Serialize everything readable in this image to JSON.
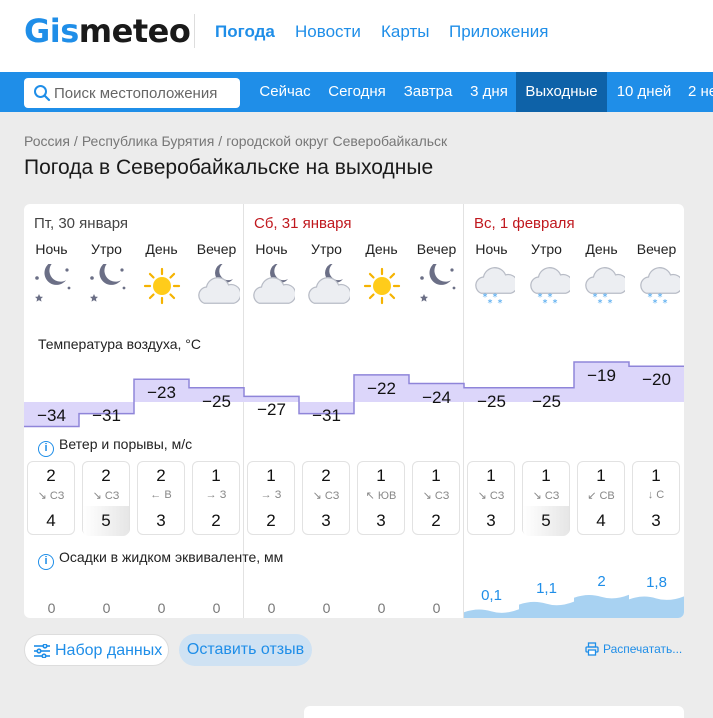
{
  "brand": {
    "logo_g": "Gis",
    "logo_rest": "meteo"
  },
  "topnav": [
    {
      "label": "Погода",
      "active": true
    },
    {
      "label": "Новости",
      "active": false
    },
    {
      "label": "Карты",
      "active": false
    },
    {
      "label": "Приложения",
      "active": false
    }
  ],
  "search": {
    "placeholder": "Поиск местоположения"
  },
  "daytabs": [
    {
      "label": "Сейчас",
      "active": false
    },
    {
      "label": "Сегодня",
      "active": false
    },
    {
      "label": "Завтра",
      "active": false
    },
    {
      "label": "3 дня",
      "active": false
    },
    {
      "label": "Выходные",
      "active": true
    },
    {
      "label": "10 дней",
      "active": false
    },
    {
      "label": "2 не",
      "active": false
    }
  ],
  "breadcrumb": [
    "Россия",
    "Республика Бурятия",
    "городской округ Северобайкальск"
  ],
  "page_title": "Погода в Северобайкальске на выходные",
  "days": [
    {
      "label": "Пт, 30 января",
      "weekend": false
    },
    {
      "label": "Сб, 31 января",
      "weekend": true
    },
    {
      "label": "Вс, 1 февраля",
      "weekend": true
    }
  ],
  "segments": [
    "Ночь",
    "Утро",
    "День",
    "Вечер"
  ],
  "icons": [
    "night-stars-icon",
    "night-stars-icon",
    "sun-icon",
    "cloud-moon-icon",
    "cloud-moon-icon",
    "cloud-moon-icon",
    "sun-icon",
    "night-stars-icon",
    "cloud-snow-icon",
    "cloud-snow-icon",
    "cloud-snow-icon",
    "cloud-snow-icon"
  ],
  "labels": {
    "temperature": "Температура воздуха, °C",
    "wind": "Ветер и порывы, м/с",
    "precip": "Осадки в жидком эквиваленте, мм",
    "info": "i"
  },
  "temperature": [
    -34,
    -31,
    -23,
    -25,
    -27,
    -31,
    -22,
    -24,
    -25,
    -25,
    -19,
    -20
  ],
  "temperature_display": [
    "−34",
    "−31",
    "−23",
    "−25",
    "−27",
    "−31",
    "−22",
    "−24",
    "−25",
    "−25",
    "−19",
    "−20"
  ],
  "wind": [
    {
      "speed": "2",
      "dir": "↘ СЗ",
      "gust": "4"
    },
    {
      "speed": "2",
      "dir": "↘ СЗ",
      "gust": "5"
    },
    {
      "speed": "2",
      "dir": "← В",
      "gust": "3"
    },
    {
      "speed": "1",
      "dir": "→ З",
      "gust": "2"
    },
    {
      "speed": "1",
      "dir": "→ З",
      "gust": "2"
    },
    {
      "speed": "2",
      "dir": "↘ СЗ",
      "gust": "3"
    },
    {
      "speed": "1",
      "dir": "↖ ЮВ",
      "gust": "3"
    },
    {
      "speed": "1",
      "dir": "↘ СЗ",
      "gust": "2"
    },
    {
      "speed": "1",
      "dir": "↘ СЗ",
      "gust": "3"
    },
    {
      "speed": "1",
      "dir": "↘ СЗ",
      "gust": "5"
    },
    {
      "speed": "1",
      "dir": "↙ СВ",
      "gust": "4"
    },
    {
      "speed": "1",
      "dir": "↓ С",
      "gust": "3"
    }
  ],
  "precip": [
    0,
    0,
    0,
    0,
    0,
    0,
    0,
    0,
    0.1,
    1.1,
    2,
    1.8
  ],
  "precip_display": [
    "0",
    "0",
    "0",
    "0",
    "0",
    "0",
    "0",
    "0",
    "0,1",
    "1,1",
    "2",
    "1,8"
  ],
  "buttons": {
    "dataset": "Набор данных",
    "feedback": "Оставить отзыв",
    "print": "Распечатать..."
  },
  "colors": {
    "accent": "#1f8ee8",
    "active_tab": "#0e62a8",
    "temp_fill": "#dcd6fa",
    "temp_line": "#8f85d9",
    "precip_fill": "#a8d2f2",
    "weekend": "#c0181e"
  }
}
